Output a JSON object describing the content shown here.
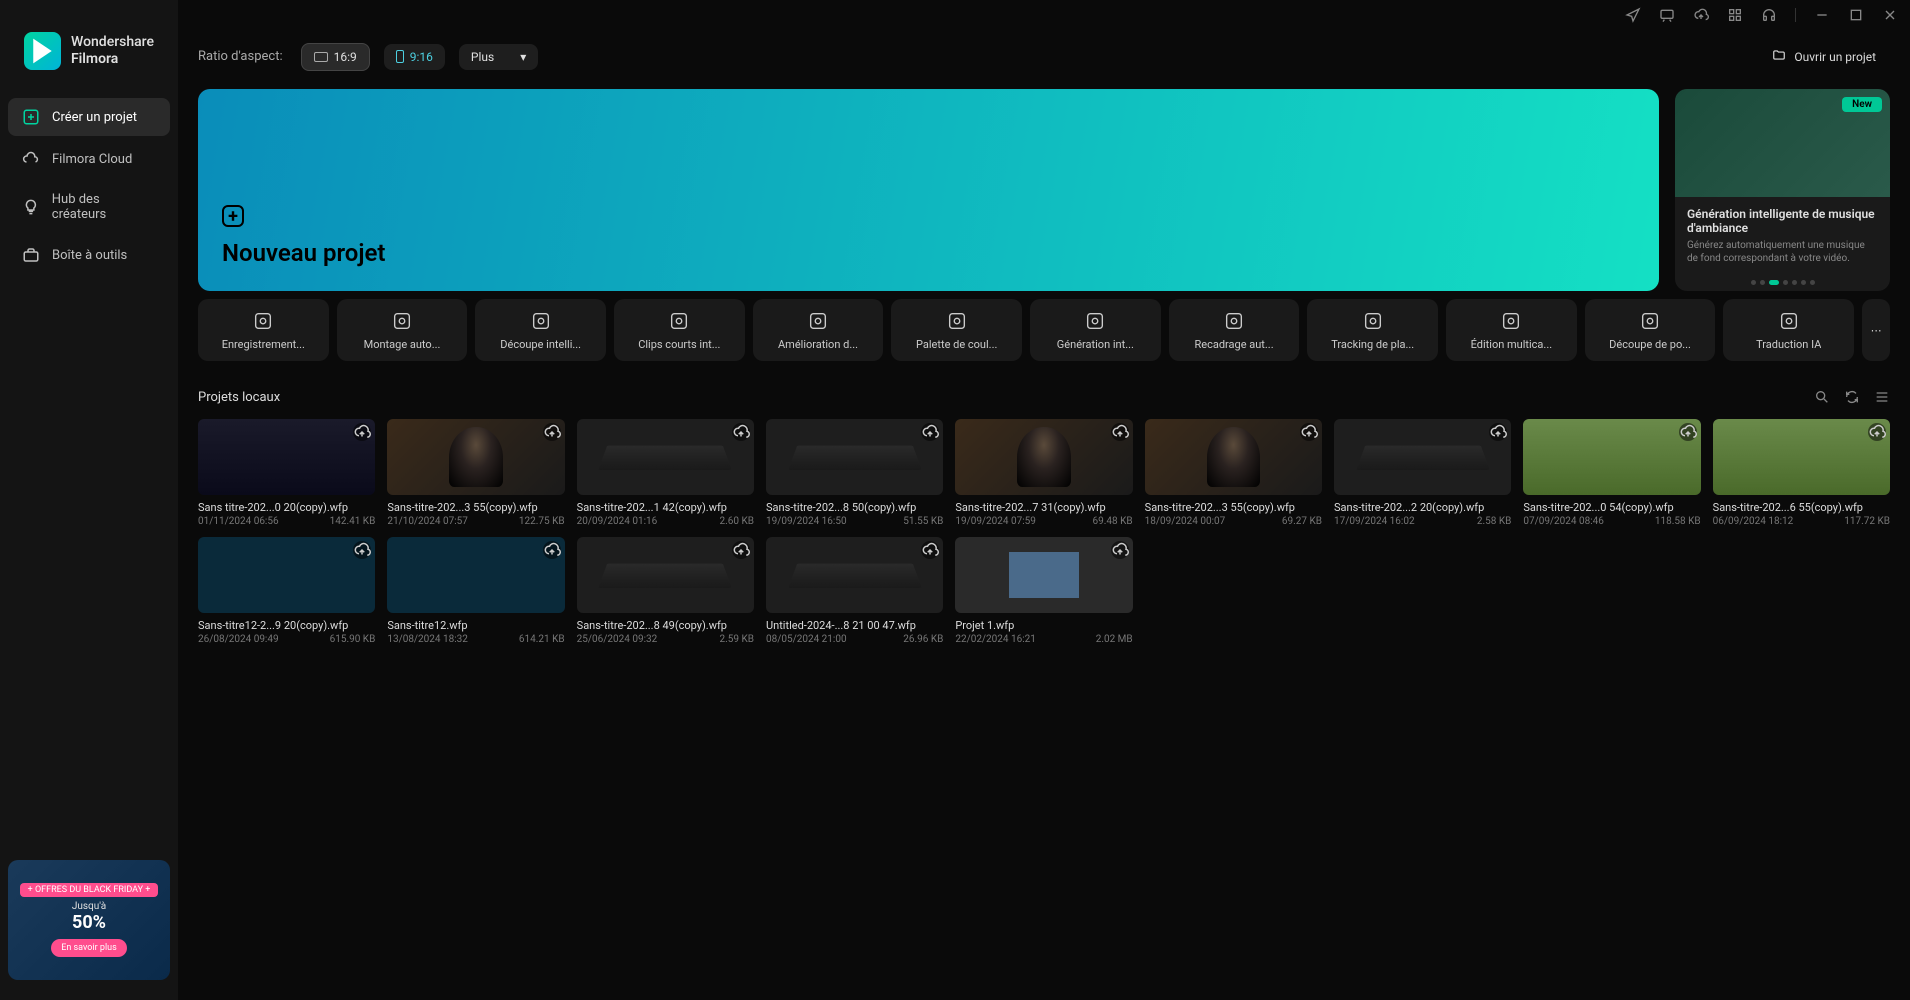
{
  "app": {
    "vendor": "Wondershare",
    "name": "Filmora"
  },
  "sidebar": {
    "items": [
      {
        "label": "Créer un projet"
      },
      {
        "label": "Filmora Cloud"
      },
      {
        "label": "Hub des créateurs"
      },
      {
        "label": "Boîte à outils"
      }
    ],
    "promo": {
      "badge": "+ OFFRES DU BLACK FRIDAY +",
      "prefix": "Jusqu'à",
      "big": "50%",
      "cta": "En savoir plus"
    }
  },
  "topbar": {
    "ratio_label": "Ratio d'aspect:",
    "ratios": [
      {
        "label": "16:9"
      },
      {
        "label": "9:16"
      }
    ],
    "plus_label": "Plus",
    "open_project": "Ouvrir un projet"
  },
  "hero": {
    "new_project": "Nouveau projet",
    "feature": {
      "new_badge": "New",
      "title": "Génération intelligente de musique d'ambiance",
      "desc": "Générez automatiquement une musique de fond correspondant à votre vidéo.",
      "active_dot": 2,
      "dot_count": 7
    }
  },
  "tools": [
    "Enregistrement...",
    "Montage auto...",
    "Découpe intelli...",
    "Clips courts int...",
    "Amélioration d...",
    "Palette de coul...",
    "Génération int...",
    "Recadrage aut...",
    "Tracking de pla...",
    "Édition multica...",
    "Découpe de po...",
    "Traduction IA"
  ],
  "more_label": "⋯",
  "section": {
    "title": "Projets locaux"
  },
  "projects": [
    {
      "name": "Sans titre-202...0 20(copy).wfp",
      "date": "01/11/2024 06:56",
      "size": "142.41 KB",
      "thumb": "editor"
    },
    {
      "name": "Sans-titre-202...3 55(copy).wfp",
      "date": "21/10/2024 07:57",
      "size": "122.75 KB",
      "thumb": "person"
    },
    {
      "name": "Sans-titre-202...1 42(copy).wfp",
      "date": "20/09/2024 01:16",
      "size": "2.60 KB",
      "thumb": "placeholder"
    },
    {
      "name": "Sans-titre-202...8 50(copy).wfp",
      "date": "19/09/2024 16:50",
      "size": "51.55 KB",
      "thumb": "placeholder"
    },
    {
      "name": "Sans-titre-202...7 31(copy).wfp",
      "date": "19/09/2024 07:59",
      "size": "69.48 KB",
      "thumb": "person"
    },
    {
      "name": "Sans-titre-202...3 55(copy).wfp",
      "date": "18/09/2024 00:07",
      "size": "69.27 KB",
      "thumb": "person"
    },
    {
      "name": "Sans-titre-202...2 20(copy).wfp",
      "date": "17/09/2024 16:02",
      "size": "2.58 KB",
      "thumb": "placeholder"
    },
    {
      "name": "Sans-titre-202...0 54(copy).wfp",
      "date": "07/09/2024 08:46",
      "size": "118.58 KB",
      "thumb": "monkey"
    },
    {
      "name": "Sans-titre-202...6 55(copy).wfp",
      "date": "06/09/2024 18:12",
      "size": "117.72 KB",
      "thumb": "monkey"
    },
    {
      "name": "Sans-titre12-2...9 20(copy).wfp",
      "date": "26/08/2024 09:49",
      "size": "615.90 KB",
      "thumb": "screen"
    },
    {
      "name": "Sans-titre12.wfp",
      "date": "13/08/2024 18:32",
      "size": "614.21 KB",
      "thumb": "screen"
    },
    {
      "name": "Sans-titre-202...8 49(copy).wfp",
      "date": "25/06/2024 09:32",
      "size": "2.59 KB",
      "thumb": "placeholder"
    },
    {
      "name": "Untitled-2024-...8 21 00 47.wfp",
      "date": "08/05/2024 21:00",
      "size": "26.96 KB",
      "thumb": "placeholder"
    },
    {
      "name": "Projet 1.wfp",
      "date": "22/02/2024 16:21",
      "size": "2.02 MB",
      "thumb": "house"
    }
  ]
}
